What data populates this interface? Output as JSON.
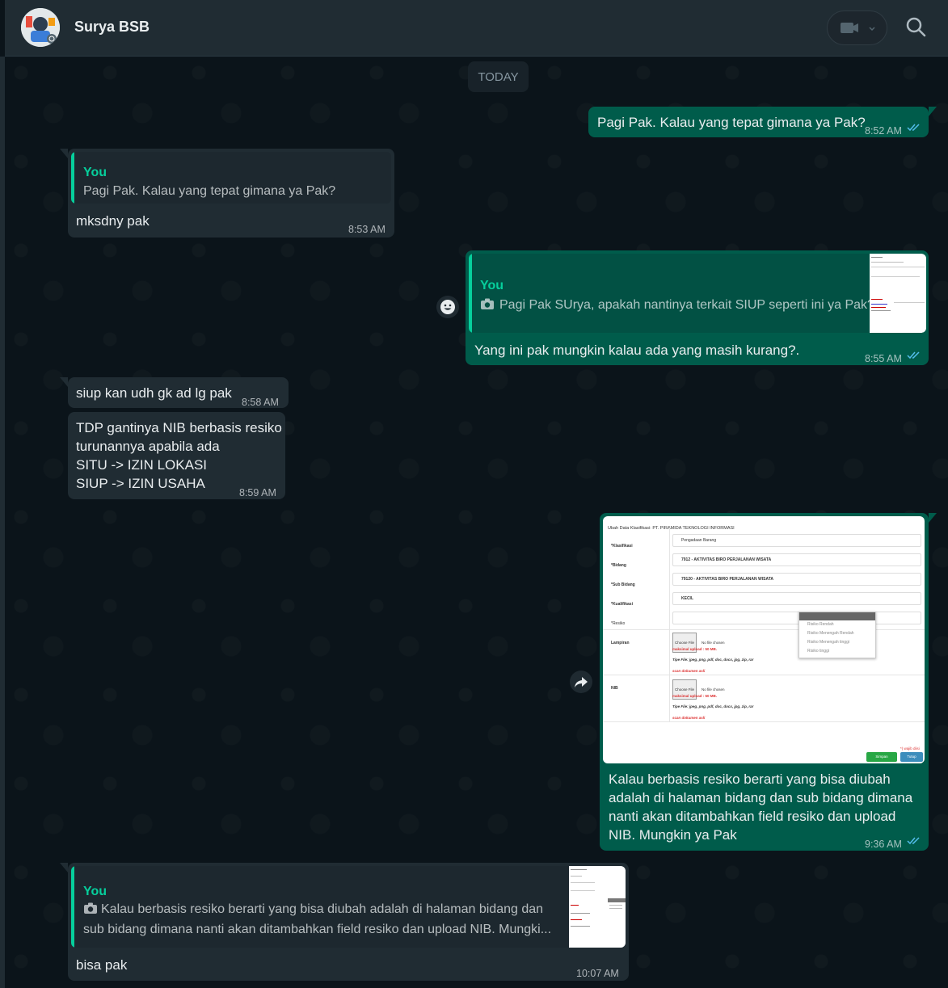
{
  "header": {
    "contact_name": "Surya BSB"
  },
  "date_chip": "TODAY",
  "messages": {
    "m1": {
      "text": "Pagi Pak. Kalau yang tepat gimana ya Pak?",
      "time": "8:52 AM"
    },
    "m2": {
      "quote_author": "You",
      "quote_text": "Pagi Pak. Kalau yang tepat gimana ya Pak?",
      "text": "mksdny pak",
      "time": "8:53 AM"
    },
    "m3": {
      "quote_author": "You",
      "quote_text": "Pagi Pak SUrya, apakah nantinya terkait SIUP seperti ini ya Pak?",
      "text": "Yang ini pak mungkin kalau ada yang masih kurang?.",
      "time": "8:55 AM"
    },
    "m4": {
      "text": "siup kan udh gk ad lg pak",
      "time": "8:58 AM"
    },
    "m5": {
      "text": "TDP gantinya NIB berbasis resiko\nturunannya apabila ada\nSITU -> IZIN LOKASI\nSIUP -> IZIN USAHA",
      "time": "8:59 AM"
    },
    "m6": {
      "text": "Kalau berbasis resiko berarti yang bisa diubah adalah di halaman bidang dan sub bidang dimana nanti akan ditambahkan field resiko dan upload NIB. Mungkin ya Pak",
      "time": "9:36 AM",
      "image": {
        "title": "Ubah Data Klasifikasi: PT. PIRAMIDA TEKNOLOGI INFORMASI",
        "rows": [
          {
            "label": "*Klasifikasi",
            "value": "Pengadaan Barang"
          },
          {
            "label": "*Bidang",
            "value": "7912 - AKTIVITAS BIRO PERJALANAN WISATA"
          },
          {
            "label": "*Sub Bidang",
            "value": "79120 - AKTIVITAS BIRO PERJALANAN WISATA"
          },
          {
            "label": "*Kualifikasi",
            "value": "KECIL"
          },
          {
            "label": "*Resiko",
            "value": ""
          }
        ],
        "dropdown_options": [
          "Risiko Rendah",
          "Risiko Menengah Rendah",
          "Risiko Menengah tinggi",
          "Risiko tinggi"
        ],
        "lampiran_label": "Lampiran",
        "nib_label": "NIB",
        "choose_file": "Choose File",
        "no_file": "No file chosen",
        "max_upload": "maksimal upload : 50 MB.",
        "file_types": "Tipe File: jpeg, png, pdf, doc, docx, jpg, zip, rar",
        "scan_text": "scan dokumen asli",
        "required_note": "*) wajib diisi",
        "save_label": "Simpan",
        "close_label": "Tutup"
      }
    },
    "m7": {
      "quote_author": "You",
      "quote_text": "Kalau berbasis resiko berarti yang bisa diubah adalah di halaman bidang dan sub bidang dimana nanti akan ditambahkan field resiko dan upload NIB. Mungki...",
      "text": "bisa pak",
      "time": "10:07 AM"
    }
  },
  "icons": {
    "video": "video-camera-icon",
    "search": "search-icon",
    "camera": "camera-icon",
    "emoji": "emoji-icon",
    "forward": "forward-icon",
    "ticks": "double-check-icon"
  },
  "colors": {
    "background": "#0b141a",
    "header": "#202c33",
    "outgoing": "#005c4b",
    "incoming": "#202c33",
    "accent": "#06cf9c",
    "read_ticks": "#53bdeb"
  }
}
